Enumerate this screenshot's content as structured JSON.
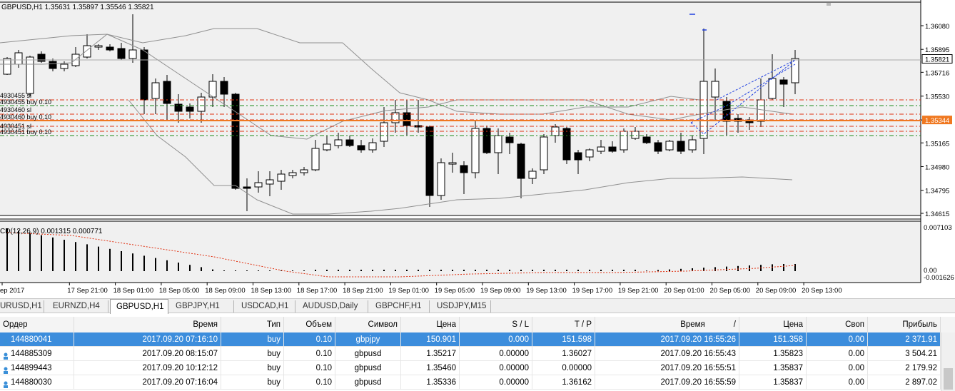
{
  "chart": {
    "title": "GBPUSD,H1",
    "ohlc": "1.35631 1.35897 1.35546 1.35821",
    "current_price": "1.35821",
    "line_price": "1.35344",
    "price_levels": [
      "1.36080",
      "1.35895",
      "1.35716",
      "1.35530",
      "1.35344",
      "1.35165",
      "1.34980",
      "1.34795",
      "1.34615"
    ],
    "order_labels": [
      "4930455 sl",
      "4930455 buy 0.10",
      "4930460 sl",
      "4930460 buy 0.10",
      "4930451 sl",
      "4930451 buy 0.10"
    ],
    "macd_label": "CD(12,26,9) 0.001315 0.000771",
    "macd_levels": [
      "0.007103",
      "0.00",
      "-0.001626"
    ],
    "time_labels": [
      "ep 2017",
      "17 Sep 21:00",
      "18 Sep 01:00",
      "18 Sep 05:00",
      "18 Sep 09:00",
      "18 Sep 13:00",
      "18 Sep 17:00",
      "18 Sep 21:00",
      "19 Sep 01:00",
      "19 Sep 05:00",
      "19 Sep 09:00",
      "19 Sep 13:00",
      "19 Sep 17:00",
      "19 Sep 21:00",
      "20 Sep 01:00",
      "20 Sep 05:00",
      "20 Sep 09:00",
      "20 Sep 13:00"
    ],
    "colors": {
      "background": "#ffffff",
      "plot": "#ffffff",
      "grid": "#c8c8c8",
      "bull": "#ffffff",
      "bear": "#000000",
      "price_box": "#ffffff",
      "orange_box": "#f07820",
      "red_line": "#e03010",
      "green_line": "#1a8a1a"
    }
  },
  "tabs": [
    "URUSD,H1",
    "EURNZD,H4",
    "GBPUSD,H1",
    "GBPJPY,H1",
    "USDCAD,H1",
    "AUDUSD,Daily",
    "GBPCHF,H1",
    "USDJPY,M15"
  ],
  "active_tab": 2,
  "table": {
    "headers": [
      "Ордер",
      "Время",
      "Тип",
      "Объем",
      "Символ",
      "Цена",
      "S / L",
      "T / P",
      "Время",
      "Цена",
      "Своп",
      "Прибыль"
    ],
    "sort_marker": "/",
    "rows": [
      [
        "144880041",
        "2017.09.20 07:16:10",
        "buy",
        "0.10",
        "gbpjpy",
        "150.901",
        "0.000",
        "151.598",
        "2017.09.20 16:55:26",
        "151.358",
        "0.00",
        "2 371.91"
      ],
      [
        "144885309",
        "2017.09.20 08:15:07",
        "buy",
        "0.10",
        "gbpusd",
        "1.35217",
        "0.00000",
        "1.36027",
        "2017.09.20 16:55:43",
        "1.35823",
        "0.00",
        "3 504.21"
      ],
      [
        "144899443",
        "2017.09.20 10:12:12",
        "buy",
        "0.10",
        "gbpusd",
        "1.35460",
        "0.00000",
        "0.00000",
        "2017.09.20 16:55:51",
        "1.35837",
        "0.00",
        "2 179.92"
      ],
      [
        "144880030",
        "2017.09.20 07:16:04",
        "buy",
        "0.10",
        "gbpusd",
        "1.35336",
        "0.00000",
        "1.36162",
        "2017.09.20 16:55:59",
        "1.35837",
        "0.00",
        "2 897.02"
      ]
    ]
  }
}
